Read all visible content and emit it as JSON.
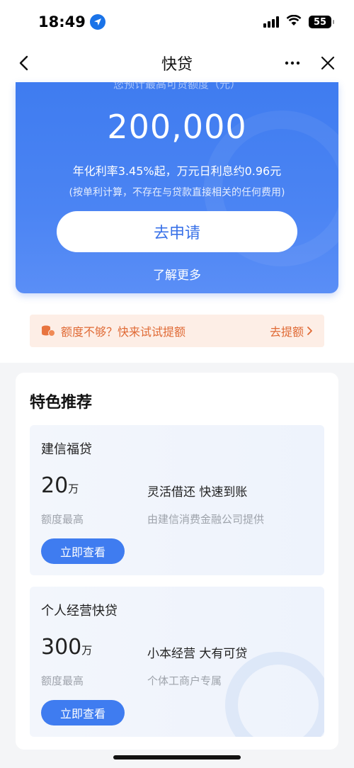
{
  "status_bar": {
    "time": "18:49",
    "battery": "55"
  },
  "nav": {
    "title": "快贷"
  },
  "hero": {
    "subtitle": "您预计最高可贷额度（元）",
    "amount": "200,000",
    "rate_text": "年化利率3.45%起，万元日利息约0.96元",
    "note": "(按单利计算，不存在与贷款直接相关的任何费用)",
    "apply_label": "去申请",
    "learn_more": "了解更多"
  },
  "quota_banner": {
    "text": "额度不够？快来试试提额",
    "action": "去提额"
  },
  "featured": {
    "title": "特色推荐",
    "products": [
      {
        "name": "建信福贷",
        "amount": "20",
        "unit": "万",
        "amount_caption": "额度最高",
        "feature": "灵活借还 快速到账",
        "provider": "由建信消费金融公司提供",
        "button": "立即查看"
      },
      {
        "name": "个人经营快贷",
        "amount": "300",
        "unit": "万",
        "amount_caption": "额度最高",
        "feature": "小本经营 大有可贷",
        "provider": "个体工商户专属",
        "button": "立即查看"
      }
    ]
  },
  "colors": {
    "primary": "#3f7cf0",
    "banner_bg": "#fdeee6",
    "banner_text": "#e06a35"
  }
}
